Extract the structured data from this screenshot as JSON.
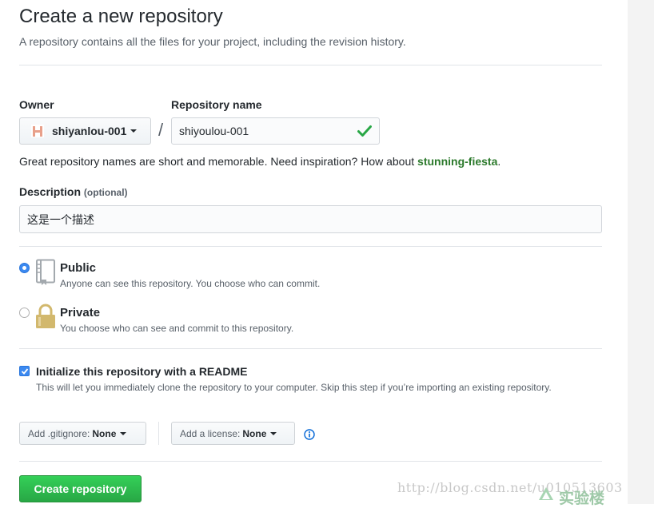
{
  "page": {
    "title": "Create a new repository",
    "subtitle": "A repository contains all the files for your project, including the revision history."
  },
  "owner": {
    "label": "Owner",
    "selected": "shiyanlou-001"
  },
  "separator": "/",
  "repo_name": {
    "label": "Repository name",
    "value": "shiyoulou-001"
  },
  "hint": {
    "text": "Great repository names are short and memorable. Need inspiration? How about ",
    "suggestion": "stunning-fiesta",
    "end": "."
  },
  "description": {
    "label": "Description",
    "optional": "(optional)",
    "value": "这是一个描述"
  },
  "visibility": {
    "public": {
      "title": "Public",
      "desc": "Anyone can see this repository. You choose who can commit.",
      "selected": true
    },
    "private": {
      "title": "Private",
      "desc": "You choose who can see and commit to this repository.",
      "selected": false
    }
  },
  "readme": {
    "title": "Initialize this repository with a README",
    "desc": "This will let you immediately clone the repository to your computer. Skip this step if you’re importing an existing repository.",
    "checked": true
  },
  "gitignore": {
    "label": "Add .gitignore:",
    "value": "None"
  },
  "license": {
    "label": "Add a license:",
    "value": "None"
  },
  "create_button": "Create repository",
  "watermark": {
    "url": "http://blog.csdn.net/u010513603",
    "brand": "实验楼"
  },
  "colors": {
    "accent_blue": "#3b89f0",
    "success_green": "#28a745",
    "suggestion_green": "#2c7a2c"
  }
}
